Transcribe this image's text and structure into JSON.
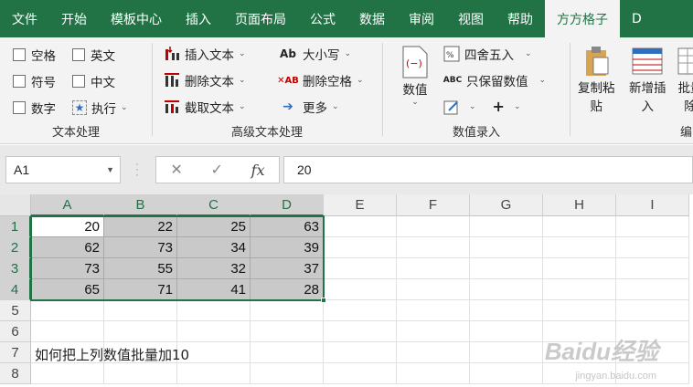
{
  "tabs": [
    "文件",
    "开始",
    "模板中心",
    "插入",
    "页面布局",
    "公式",
    "数据",
    "审阅",
    "视图",
    "帮助",
    "方方格子",
    "D"
  ],
  "active_tab_index": 10,
  "ribbon": {
    "text_group": {
      "label": "文本处理",
      "checkboxes": [
        "空格",
        "英文",
        "符号",
        "中文",
        "数字"
      ],
      "execute": "执行"
    },
    "adv_text_group": {
      "label": "高级文本处理",
      "insert_text": "插入文本",
      "delete_text": "删除文本",
      "cut_text": "截取文本",
      "case": "大小写",
      "delete_spaces": "删除空格",
      "more": "更多"
    },
    "numeric_group": {
      "label": "数值录入",
      "value_btn": "数值",
      "round": "四舍五入",
      "keep_values": "只保留数值",
      "plus": "+"
    },
    "edit_group": {
      "label": "编",
      "copy_paste": [
        "复制粘",
        "贴"
      ],
      "new_insert": [
        "新增插",
        "入"
      ],
      "batch": [
        "批量",
        "除"
      ]
    }
  },
  "formula_bar": {
    "name_box": "A1",
    "cancel_icon": "✕",
    "confirm_icon": "✓",
    "fx": "fx",
    "value": "20"
  },
  "columns": [
    "A",
    "B",
    "C",
    "D",
    "E",
    "F",
    "G",
    "H",
    "I"
  ],
  "rows": [
    "1",
    "2",
    "3",
    "4",
    "5",
    "6",
    "7",
    "8"
  ],
  "cells": [
    [
      "20",
      "22",
      "25",
      "63"
    ],
    [
      "62",
      "73",
      "34",
      "39"
    ],
    [
      "73",
      "55",
      "32",
      "37"
    ],
    [
      "65",
      "71",
      "41",
      "28"
    ]
  ],
  "note_text": "如何把上列数值批量加10",
  "watermark": "Baidu经验",
  "watermark_url": "jingyan.baidu.com",
  "colors": {
    "accent": "#217346",
    "selection_fill": "#c9c9c9"
  }
}
